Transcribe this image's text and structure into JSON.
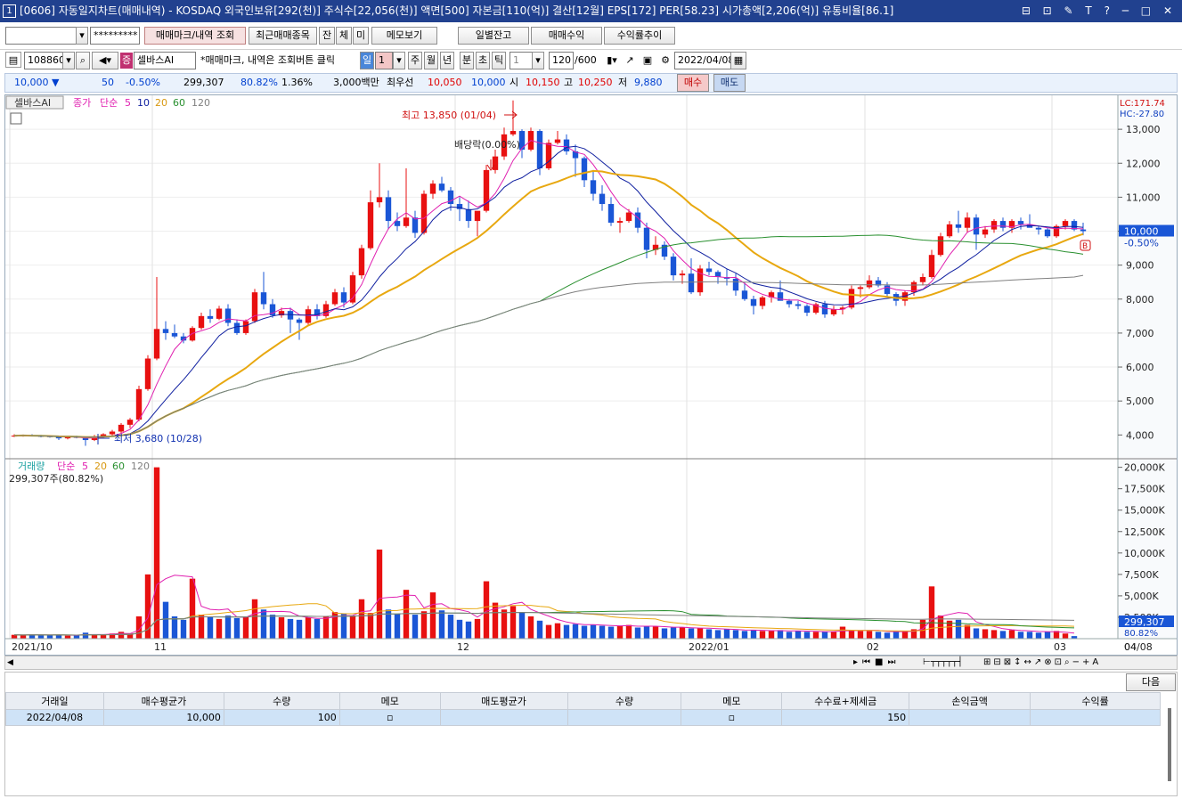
{
  "window": {
    "number": "1",
    "title": "[0606] 자동일지차트(매매내역) - KOSDAQ 외국인보유[292(천)] 주식수[22,056(천)] 액면[500] 자본금[110(억)] 결산[12월] EPS[172] PER[58.23] 시가총액[2,206(억)] 유통비율[86.1]",
    "controls": "⊟ ⊡ ✎ T ? ─ □ ✕"
  },
  "toolbar1": {
    "account_value": "",
    "password_mask": "*********",
    "btn_marks": "매매마크/내역 조회",
    "btn_recent": "최근매매종목",
    "btn_jan": "잔",
    "btn_che": "체",
    "btn_mi": "미",
    "btn_memo": "메모보기",
    "btn_daily": "일별잔고",
    "btn_profit": "매매수익",
    "btn_trend": "수익률추이"
  },
  "toolbar2": {
    "code": "108860",
    "stock_name": "셀바스AI",
    "jeung": "증",
    "hint": "*매매마크, 내역은 조회버튼 클릭",
    "period_day": "일",
    "period_num": "1",
    "p_week": "주",
    "p_month": "월",
    "p_year": "년",
    "p_min": "분",
    "p_sec": "초",
    "p_tick": "틱",
    "tick_num": "1",
    "count": "120",
    "count_max": "/600",
    "date": "2022/04/08"
  },
  "quote": {
    "price": "10,000 ▼",
    "change": "50",
    "change_pct": "-0.50%",
    "volume": "299,307",
    "vol_ratio": "80.82%",
    "turnover": "1.36%",
    "amount": "3,000백만",
    "best_label": "최우선",
    "bid": "10,050",
    "ask": "10,000",
    "open_label": "시",
    "open": "10,150",
    "high_label": "고",
    "high": "10,250",
    "low_label": "저",
    "low": "9,880",
    "buy_btn": "매수",
    "sell_btn": "매도"
  },
  "price_legend": {
    "name": "셀바스AI",
    "close": "종가",
    "method": "단순",
    "ma5": "5",
    "ma10": "10",
    "ma20": "20",
    "ma60": "60",
    "ma120": "120",
    "lc": "LC:171.74",
    "hc": "HC:-27.80"
  },
  "annotations": {
    "high": "최고 13,850 (01/04)",
    "low": "최저 3,680 (10/28)",
    "dividend": "배당락(0.00%)",
    "marker": "B"
  },
  "volume_legend": {
    "label": "거래량",
    "method": "단순",
    "ma5": "5",
    "ma20": "20",
    "ma60": "60",
    "ma120": "120",
    "current": "299,307주(80.82%)"
  },
  "right_labels": {
    "price": "10,000",
    "pct": "-0.50%",
    "vol": "299,307",
    "vol_pct": "80.82%"
  },
  "price_axis": [
    "13,000",
    "12,000",
    "11,000",
    "10,000",
    "9,000",
    "8,000",
    "7,000",
    "6,000",
    "5,000",
    "4,000"
  ],
  "volume_axis": [
    "20,000K",
    "17,500K",
    "15,000K",
    "12,500K",
    "10,000K",
    "7,500K",
    "5,000K",
    "2,500K"
  ],
  "date_axis": [
    "2021/10",
    "11",
    "12",
    "2022/01",
    "02",
    "03",
    "04",
    "04/08"
  ],
  "colors": {
    "up": "#e81010",
    "down": "#1a56d6",
    "ma5": "#e020b0",
    "ma10": "#1020a0",
    "ma20": "#e8a810",
    "ma60": "#2a9030",
    "ma120": "#808080"
  },
  "table": {
    "next_btn": "다음",
    "headers": [
      "거래일",
      "매수평균가",
      "수량",
      "메모",
      "매도평균가",
      "수량",
      "메모",
      "수수료+제세금",
      "손익금액",
      "수익률"
    ],
    "rows": [
      {
        "date": "2022/04/08",
        "buy_avg": "10,000",
        "qty": "100",
        "memo": "",
        "sell_avg": "",
        "qty2": "",
        "memo2": "",
        "fee": "150",
        "pnl": "",
        "rate": ""
      }
    ]
  },
  "chart_data": {
    "type": "candlestick",
    "candles": [
      [
        3.98,
        4.02,
        3.94,
        3.98
      ],
      [
        3.98,
        4.01,
        3.95,
        3.99
      ],
      [
        3.99,
        4.02,
        3.96,
        3.97
      ],
      [
        3.97,
        4.0,
        3.93,
        3.96
      ],
      [
        3.96,
        3.99,
        3.92,
        3.95
      ],
      [
        3.95,
        3.97,
        3.85,
        3.9
      ],
      [
        3.9,
        3.96,
        3.87,
        3.94
      ],
      [
        3.94,
        3.98,
        3.9,
        3.92
      ],
      [
        3.92,
        3.95,
        3.68,
        3.85
      ],
      [
        3.85,
        4.0,
        3.82,
        3.95
      ],
      [
        3.95,
        4.05,
        3.9,
        4.02
      ],
      [
        4.02,
        4.15,
        3.98,
        4.1
      ],
      [
        4.1,
        4.35,
        4.05,
        4.3
      ],
      [
        4.3,
        4.5,
        4.2,
        4.45
      ],
      [
        4.45,
        5.45,
        4.4,
        5.35
      ],
      [
        5.35,
        6.35,
        5.3,
        6.25
      ],
      [
        6.25,
        8.65,
        6.2,
        7.12
      ],
      [
        7.12,
        7.35,
        6.8,
        7.0
      ],
      [
        7.0,
        7.25,
        6.85,
        6.9
      ],
      [
        6.9,
        7.0,
        6.7,
        6.78
      ],
      [
        6.78,
        7.2,
        6.75,
        7.15
      ],
      [
        7.15,
        7.6,
        7.1,
        7.5
      ],
      [
        7.5,
        7.7,
        7.3,
        7.42
      ],
      [
        7.42,
        7.8,
        7.38,
        7.72
      ],
      [
        7.72,
        7.85,
        7.2,
        7.3
      ],
      [
        7.3,
        7.4,
        6.95,
        7.0
      ],
      [
        7.0,
        7.4,
        6.95,
        7.35
      ],
      [
        7.35,
        8.3,
        7.3,
        8.2
      ],
      [
        8.2,
        8.8,
        7.7,
        7.85
      ],
      [
        7.85,
        8.0,
        7.45,
        7.52
      ],
      [
        7.52,
        7.75,
        7.45,
        7.65
      ],
      [
        7.65,
        7.75,
        7.0,
        7.4
      ],
      [
        7.4,
        7.45,
        6.8,
        7.3
      ],
      [
        7.3,
        7.8,
        7.25,
        7.7
      ],
      [
        7.7,
        7.85,
        7.4,
        7.5
      ],
      [
        7.5,
        7.95,
        7.45,
        7.85
      ],
      [
        7.85,
        8.3,
        7.8,
        8.2
      ],
      [
        8.2,
        8.35,
        7.75,
        7.9
      ],
      [
        7.9,
        8.8,
        7.85,
        8.7
      ],
      [
        8.7,
        9.6,
        8.6,
        9.5
      ],
      [
        9.5,
        11.2,
        9.45,
        10.85
      ],
      [
        10.85,
        12.0,
        10.7,
        11.0
      ],
      [
        11.0,
        11.2,
        10.05,
        10.3
      ],
      [
        10.3,
        10.55,
        10.0,
        10.15
      ],
      [
        10.15,
        11.85,
        10.1,
        10.4
      ],
      [
        10.4,
        10.6,
        9.8,
        9.95
      ],
      [
        9.95,
        11.2,
        9.9,
        11.1
      ],
      [
        11.1,
        11.5,
        10.95,
        11.4
      ],
      [
        11.4,
        11.6,
        11.15,
        11.2
      ],
      [
        11.2,
        11.3,
        10.6,
        10.8
      ],
      [
        10.8,
        11.0,
        10.3,
        10.65
      ],
      [
        10.65,
        10.9,
        10.1,
        10.3
      ],
      [
        10.3,
        10.45,
        9.85,
        10.6
      ],
      [
        10.6,
        11.95,
        10.55,
        11.8
      ],
      [
        11.8,
        12.4,
        11.7,
        12.2
      ],
      [
        12.2,
        13.05,
        12.1,
        12.85
      ],
      [
        12.85,
        13.85,
        12.8,
        12.95
      ],
      [
        12.95,
        13.0,
        12.15,
        12.4
      ],
      [
        12.4,
        13.05,
        12.35,
        12.95
      ],
      [
        12.95,
        13.0,
        11.65,
        11.85
      ],
      [
        11.85,
        12.7,
        11.8,
        12.6
      ],
      [
        12.6,
        12.95,
        12.55,
        12.7
      ],
      [
        12.7,
        12.85,
        12.25,
        12.35
      ],
      [
        12.35,
        12.55,
        11.6,
        12.15
      ],
      [
        12.15,
        12.2,
        11.3,
        11.5
      ],
      [
        11.5,
        11.8,
        10.9,
        11.1
      ],
      [
        11.1,
        11.35,
        10.6,
        10.8
      ],
      [
        10.8,
        11.0,
        10.15,
        10.25
      ],
      [
        10.25,
        10.4,
        9.95,
        10.3
      ],
      [
        10.3,
        10.65,
        10.25,
        10.55
      ],
      [
        10.55,
        10.7,
        9.95,
        10.1
      ],
      [
        10.1,
        10.25,
        9.2,
        9.45
      ],
      [
        9.45,
        9.85,
        9.3,
        9.6
      ],
      [
        9.6,
        9.7,
        9.15,
        9.25
      ],
      [
        9.25,
        9.35,
        8.55,
        8.7
      ],
      [
        8.7,
        8.85,
        8.45,
        8.75
      ],
      [
        8.75,
        9.2,
        8.15,
        8.2
      ],
      [
        8.2,
        9.0,
        8.1,
        8.9
      ],
      [
        8.9,
        9.1,
        8.7,
        8.8
      ],
      [
        8.8,
        8.85,
        8.45,
        8.65
      ],
      [
        8.65,
        8.9,
        8.4,
        8.6
      ],
      [
        8.6,
        8.75,
        8.1,
        8.25
      ],
      [
        8.25,
        8.5,
        7.95,
        8.0
      ],
      [
        8.0,
        8.1,
        7.55,
        7.8
      ],
      [
        7.8,
        8.1,
        7.7,
        8.05
      ],
      [
        8.05,
        8.25,
        7.9,
        8.2
      ],
      [
        8.2,
        8.55,
        8.05,
        7.95
      ],
      [
        7.95,
        8.0,
        7.75,
        7.85
      ],
      [
        7.85,
        7.95,
        7.7,
        7.8
      ],
      [
        7.8,
        7.85,
        7.5,
        7.6
      ],
      [
        7.6,
        7.9,
        7.55,
        7.85
      ],
      [
        7.85,
        7.95,
        7.45,
        7.55
      ],
      [
        7.55,
        7.8,
        7.5,
        7.7
      ],
      [
        7.7,
        7.8,
        7.55,
        7.75
      ],
      [
        7.75,
        8.4,
        7.7,
        8.3
      ],
      [
        8.3,
        8.4,
        8.05,
        8.35
      ],
      [
        8.35,
        8.7,
        8.3,
        8.55
      ],
      [
        8.55,
        8.65,
        8.35,
        8.4
      ],
      [
        8.4,
        8.5,
        8.05,
        8.15
      ],
      [
        8.15,
        8.2,
        7.8,
        7.95
      ],
      [
        7.95,
        8.25,
        7.8,
        8.2
      ],
      [
        8.2,
        8.55,
        8.1,
        8.5
      ],
      [
        8.5,
        8.75,
        8.4,
        8.65
      ],
      [
        8.65,
        9.45,
        8.6,
        9.3
      ],
      [
        9.3,
        9.95,
        9.25,
        9.85
      ],
      [
        9.85,
        10.3,
        9.8,
        10.2
      ],
      [
        10.2,
        10.6,
        9.95,
        10.1
      ],
      [
        10.1,
        10.55,
        9.95,
        10.4
      ],
      [
        10.4,
        10.5,
        9.45,
        9.9
      ],
      [
        9.9,
        10.15,
        9.8,
        10.05
      ],
      [
        10.05,
        10.35,
        9.95,
        10.3
      ],
      [
        10.3,
        10.4,
        10.0,
        10.1
      ],
      [
        10.1,
        10.35,
        9.95,
        10.3
      ],
      [
        10.3,
        10.4,
        10.05,
        10.2
      ],
      [
        10.2,
        10.5,
        10.15,
        10.1
      ],
      [
        10.1,
        10.15,
        9.9,
        10.05
      ],
      [
        10.05,
        10.1,
        9.8,
        9.85
      ],
      [
        9.85,
        10.2,
        9.8,
        10.15
      ],
      [
        10.15,
        10.35,
        10.05,
        10.3
      ],
      [
        10.3,
        10.35,
        10.0,
        10.05
      ],
      [
        10.05,
        10.25,
        9.88,
        10.0
      ]
    ],
    "volumes": [
      0.45,
      0.4,
      0.5,
      0.38,
      0.42,
      0.45,
      0.35,
      0.4,
      0.7,
      0.5,
      0.45,
      0.6,
      0.8,
      0.6,
      2.6,
      7.5,
      20.0,
      4.3,
      2.6,
      2.2,
      7.0,
      2.8,
      2.5,
      2.3,
      2.7,
      2.4,
      2.6,
      4.6,
      3.4,
      2.8,
      2.5,
      2.3,
      2.2,
      2.5,
      2.3,
      2.6,
      3.1,
      2.9,
      2.6,
      4.6,
      3.0,
      10.4,
      3.4,
      2.9,
      5.7,
      2.8,
      3.2,
      5.4,
      3.3,
      2.8,
      2.2,
      2.0,
      2.3,
      6.7,
      4.2,
      3.4,
      3.8,
      3.1,
      2.6,
      2.1,
      1.6,
      1.8,
      1.6,
      1.7,
      1.5,
      1.6,
      1.5,
      1.4,
      1.5,
      1.6,
      1.3,
      1.5,
      1.4,
      1.2,
      1.3,
      1.3,
      1.2,
      1.2,
      1.1,
      1.0,
      1.1,
      1.0,
      0.9,
      1.0,
      0.9,
      0.9,
      1.0,
      0.8,
      0.9,
      0.8,
      0.8,
      0.8,
      0.8,
      1.4,
      0.9,
      0.9,
      0.9,
      0.8,
      0.7,
      0.8,
      0.9,
      1.1,
      2.2,
      6.1,
      2.7,
      2.1,
      2.2,
      1.6,
      1.2,
      1.1,
      1.0,
      0.9,
      1.0,
      0.8,
      0.8,
      0.7,
      0.8,
      0.9,
      0.6,
      0.3
    ],
    "price_range": [
      3.3,
      14.0
    ],
    "volume_range": [
      0,
      21.0
    ],
    "price_unit": "천",
    "volume_unit": "백만주"
  }
}
